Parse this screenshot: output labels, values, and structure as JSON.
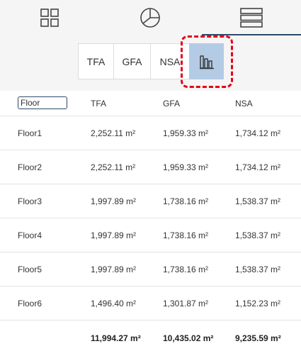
{
  "view_tabs": [
    {
      "icon": "grid-icon"
    },
    {
      "icon": "pie-chart-icon"
    },
    {
      "icon": "list-rows-icon"
    }
  ],
  "metric_buttons": {
    "tfa": "TFA",
    "gfa": "GFA",
    "nsa": "NSA",
    "chart_icon": "bar-chart-icon"
  },
  "colors": {
    "active_segment": "#b4cbe6",
    "highlight": "#e2001a",
    "accent": "#2f4a6b"
  },
  "table": {
    "filter_value": "Floor",
    "headers": [
      "TFA",
      "GFA",
      "NSA"
    ],
    "rows": [
      {
        "floor": "Floor1",
        "tfa": "2,252.11 m²",
        "gfa": "1,959.33 m²",
        "nsa": "1,734.12 m²"
      },
      {
        "floor": "Floor2",
        "tfa": "2,252.11 m²",
        "gfa": "1,959.33 m²",
        "nsa": "1,734.12 m²"
      },
      {
        "floor": "Floor3",
        "tfa": "1,997.89 m²",
        "gfa": "1,738.16 m²",
        "nsa": "1,538.37 m²"
      },
      {
        "floor": "Floor4",
        "tfa": "1,997.89 m²",
        "gfa": "1,738.16 m²",
        "nsa": "1,538.37 m²"
      },
      {
        "floor": "Floor5",
        "tfa": "1,997.89 m²",
        "gfa": "1,738.16 m²",
        "nsa": "1,538.37 m²"
      },
      {
        "floor": "Floor6",
        "tfa": "1,496.40 m²",
        "gfa": "1,301.87 m²",
        "nsa": "1,152.23 m²"
      }
    ],
    "totals": {
      "tfa": "11,994.27 m²",
      "gfa": "10,435.02 m²",
      "nsa": "9,235.59 m²"
    }
  }
}
